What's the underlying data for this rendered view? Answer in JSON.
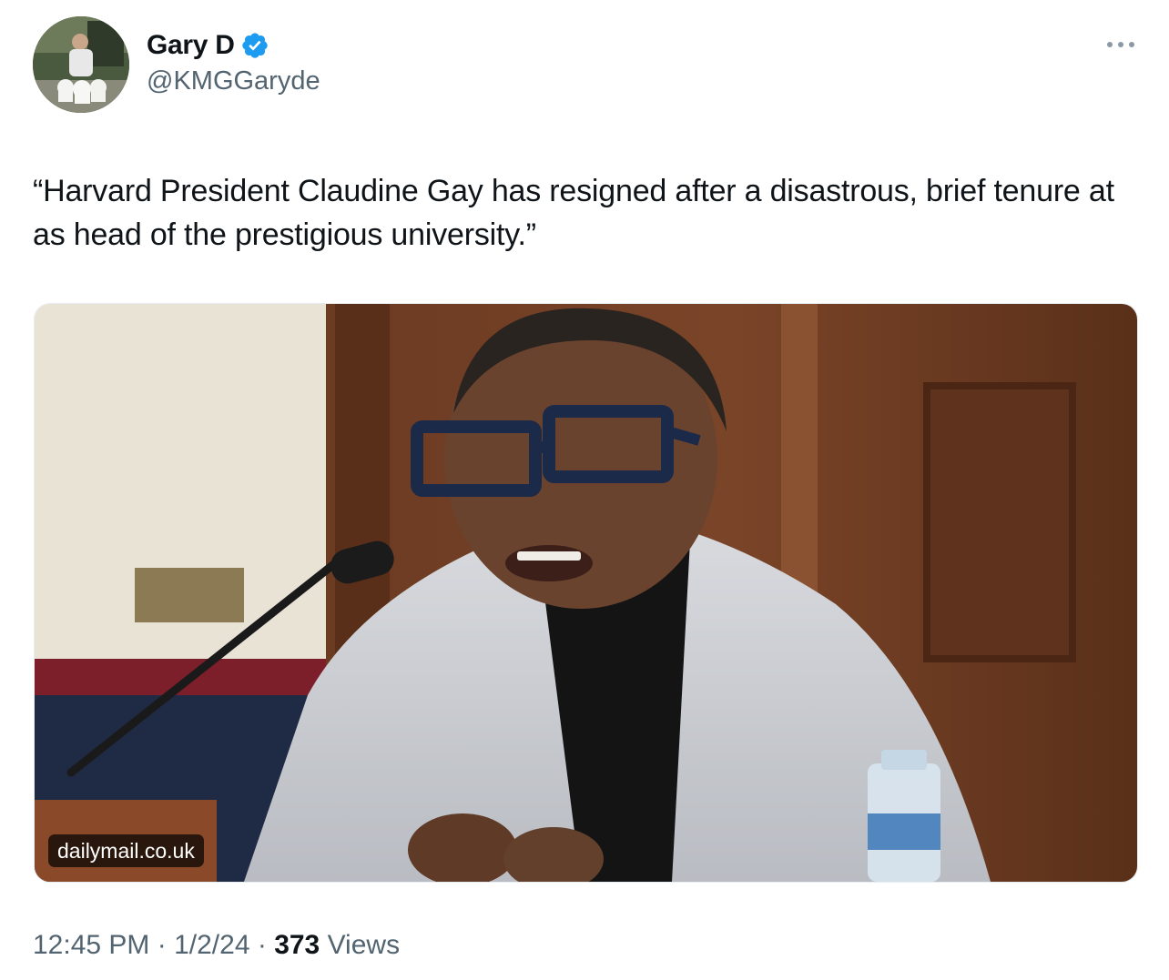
{
  "author": {
    "display_name": "Gary D",
    "handle": "@KMGGaryde",
    "verified": true,
    "avatar_icon": "user-avatar-photo"
  },
  "tweet": {
    "text": "“Harvard President Claudine Gay has resigned after a disastrous, brief tenure at as head of the prestigious university.”"
  },
  "media": {
    "source_label": "dailymail.co.uk"
  },
  "meta": {
    "time": "12:45 PM",
    "separator": " · ",
    "date": "1/2/24",
    "views_count": "373",
    "views_label": " Views"
  },
  "icons": {
    "verified": "verified-badge-icon",
    "more": "more-dots-icon"
  },
  "colors": {
    "verified_blue": "#1d9bf0",
    "text_primary": "#0f1419",
    "text_secondary": "#536471"
  }
}
